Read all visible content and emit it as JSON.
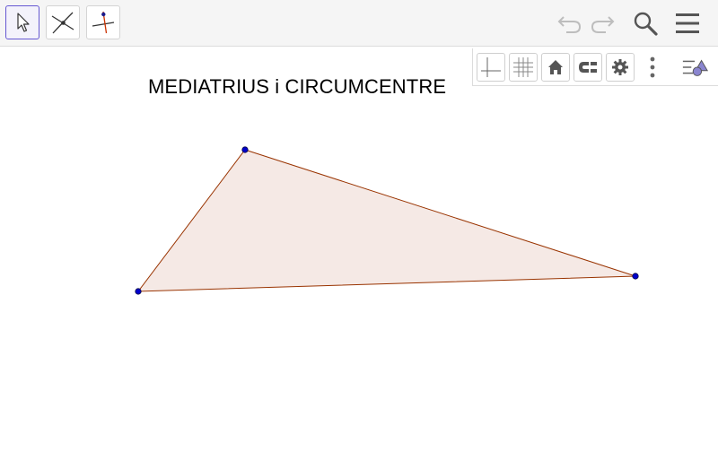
{
  "toolbar": {
    "tools": [
      {
        "name": "Move",
        "icon": "move-arrow-icon",
        "selected": true
      },
      {
        "name": "Intersect",
        "icon": "intersect-icon",
        "selected": false
      },
      {
        "name": "Perpendicular Bisector",
        "icon": "perpendicular-bisector-icon",
        "selected": false
      }
    ],
    "right_icons": [
      "undo-icon",
      "redo-icon",
      "search-icon",
      "menu-icon"
    ]
  },
  "style_bar": {
    "buttons": [
      "axes-icon",
      "grid-icon",
      "home-icon",
      "point-capturing-icon",
      "settings-gear-icon",
      "more-vertical-icon",
      "algebra-toggle-icon"
    ]
  },
  "canvas": {
    "title": "MEDIATRIUS i CIRCUMCENTRE",
    "colors": {
      "triangle_fill": "#f5e9e5",
      "triangle_stroke": "#993300",
      "point": "#0000cc",
      "accent": "#6557d2"
    }
  }
}
